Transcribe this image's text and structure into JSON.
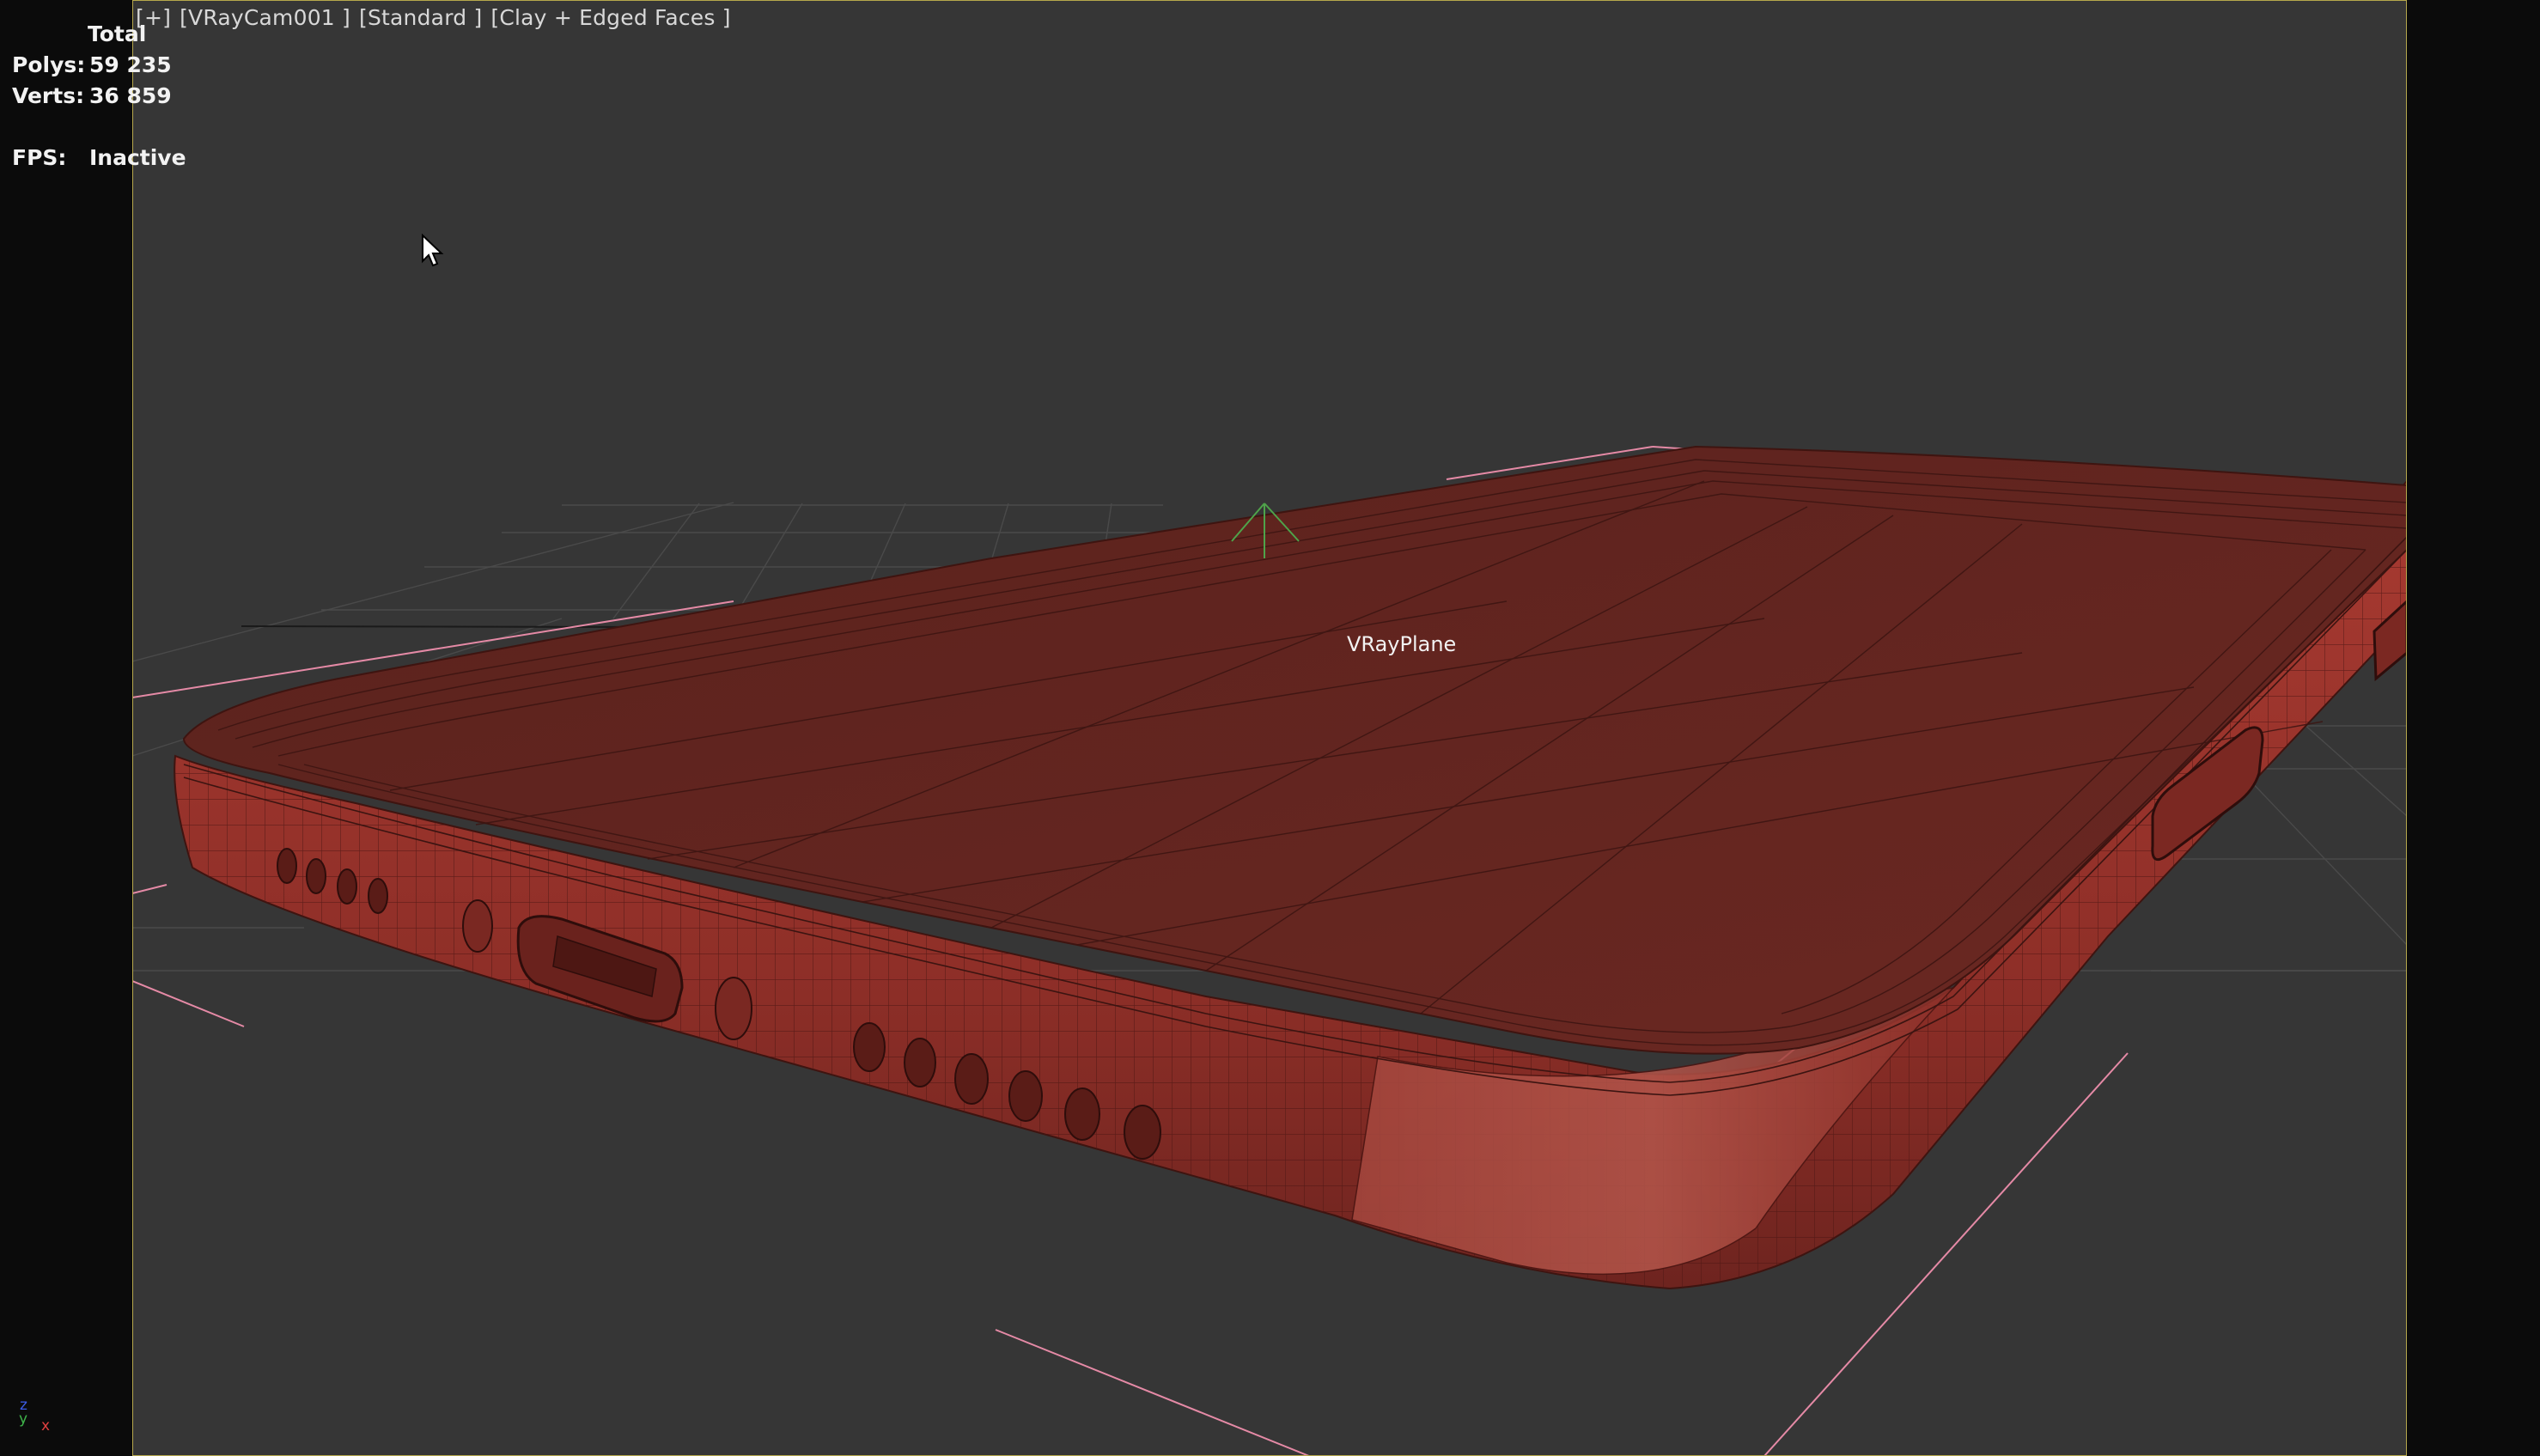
{
  "viewport": {
    "menu_plus": "[+]",
    "camera": "[VRayCam001 ]",
    "shading_standard": "[Standard ]",
    "shading_mode": "[Clay + Edged Faces ]"
  },
  "stats": {
    "total_label": "Total",
    "polys_label": "Polys:",
    "polys_value": "59 235",
    "verts_label": "Verts:",
    "verts_value": "36 859",
    "fps_label": "FPS:",
    "fps_value": "Inactive"
  },
  "scene": {
    "object_label": "VRayPlane",
    "model_color": "#8a2e27",
    "top_color": "#62251f",
    "grid_color": "#4a4a4a",
    "helper_color": "#e58aa6"
  },
  "axis": {
    "z": "z",
    "y": "y",
    "x": "x"
  },
  "icons": {
    "cursor": "mouse-pointer-icon",
    "axis": "axis-tripod-icon"
  }
}
